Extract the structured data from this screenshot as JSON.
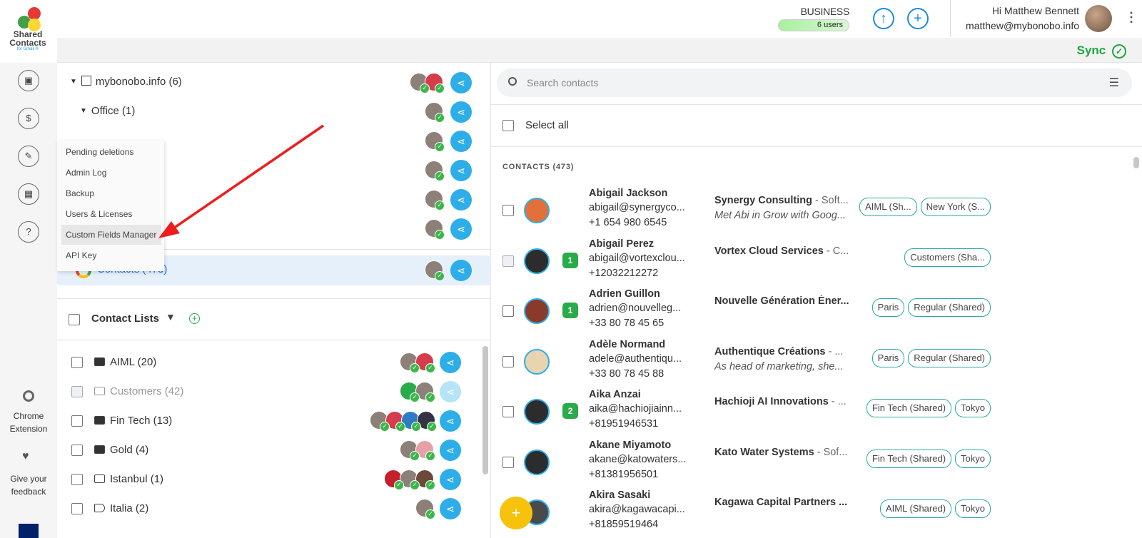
{
  "header": {
    "logo_line1": "Shared",
    "logo_line2": "Contacts",
    "logo_line3": "for Gmail ®",
    "plan_name": "BUSINESS",
    "plan_users": "6 users",
    "greeting": "Hi",
    "user_name": "Matthew Bennett",
    "user_email": "matthew@mybonobo.info",
    "sync_label": "Sync"
  },
  "leftnav": {
    "chrome_extension": "Chrome Extension",
    "feedback": "Give your feedback",
    "help_glyph": "?",
    "dollar_glyph": "$"
  },
  "menu": {
    "items": [
      "Pending deletions",
      "Admin Log",
      "Backup",
      "Users & Licenses",
      "Custom Fields Manager",
      "API Key"
    ]
  },
  "accounts": {
    "root_label": "mybonobo.info (6)",
    "office_label": "Office (1)",
    "contacts_label": "Contacts (473)"
  },
  "contact_lists": {
    "title": "Contact Lists",
    "items": [
      {
        "name": "AIML",
        "count": "(20)"
      },
      {
        "name": "Customers",
        "count": "(42)"
      },
      {
        "name": "Fin Tech",
        "count": "(13)"
      },
      {
        "name": "Gold",
        "count": "(4)"
      },
      {
        "name": "Istanbul",
        "count": "(1)"
      },
      {
        "name": "Italia",
        "count": "(2)"
      }
    ]
  },
  "contacts": {
    "search_placeholder": "Search contacts",
    "select_all": "Select all",
    "count_label": "CONTACTS (473)",
    "rows": [
      {
        "name": "Abigail Jackson",
        "email": "abigail@synergyco...",
        "phone": "+1 654 980 6545",
        "org": "Synergy Consulting",
        "org_suffix": " - Soft...",
        "note": "Met Abi in Grow with Goog...",
        "badge": "",
        "tags": [
          "AIML (Sh...",
          "New York (S..."
        ]
      },
      {
        "name": "Abigail Perez",
        "email": "abigail@vortexclou...",
        "phone": "+12032212272",
        "org": "Vortex Cloud Services",
        "org_suffix": " - C...",
        "note": "",
        "badge": "1",
        "tags": [
          "Customers (Sha..."
        ]
      },
      {
        "name": "Adrien Guillon",
        "email": "adrien@nouvelleg...",
        "phone": "+33 80 78 45 65",
        "org": "Nouvelle Génération Éner...",
        "org_suffix": "",
        "note": "",
        "badge": "1",
        "tags": [
          "Paris",
          "Regular (Shared)"
        ]
      },
      {
        "name": "Adèle Normand",
        "email": "adele@authentiqu...",
        "phone": "+33 80 78 45 88",
        "org": "Authentique Créations",
        "org_suffix": " - ...",
        "note": "As head of marketing, she...",
        "badge": "",
        "tags": [
          "Paris",
          "Regular (Shared)"
        ]
      },
      {
        "name": "Aika Anzai",
        "email": "aika@hachiojiainn...",
        "phone": "+81951946531",
        "org": "Hachioji AI Innovations",
        "org_suffix": " - ...",
        "note": "",
        "badge": "2",
        "tags": [
          "Fin Tech (Shared)",
          "Tokyo"
        ]
      },
      {
        "name": "Akane Miyamoto",
        "email": "akane@katowaters...",
        "phone": "+81381956501",
        "org": "Kato Water Systems",
        "org_suffix": " - Sof...",
        "note": "",
        "badge": "",
        "tags": [
          "Fin Tech (Shared)",
          "Tokyo"
        ]
      },
      {
        "name": "Akira Sasaki",
        "email": "akira@kagawacapi...",
        "phone": "+81859519464",
        "org": "Kagawa Capital Partners ...",
        "org_suffix": "",
        "note": "",
        "badge": "",
        "tags": [
          "AIML (Shared)",
          "Tokyo"
        ]
      }
    ]
  },
  "colors": {
    "accent_blue": "#2eaee8",
    "green": "#2aab4a",
    "tag_border": "#2aa9a0",
    "fab": "#f7c20c"
  }
}
